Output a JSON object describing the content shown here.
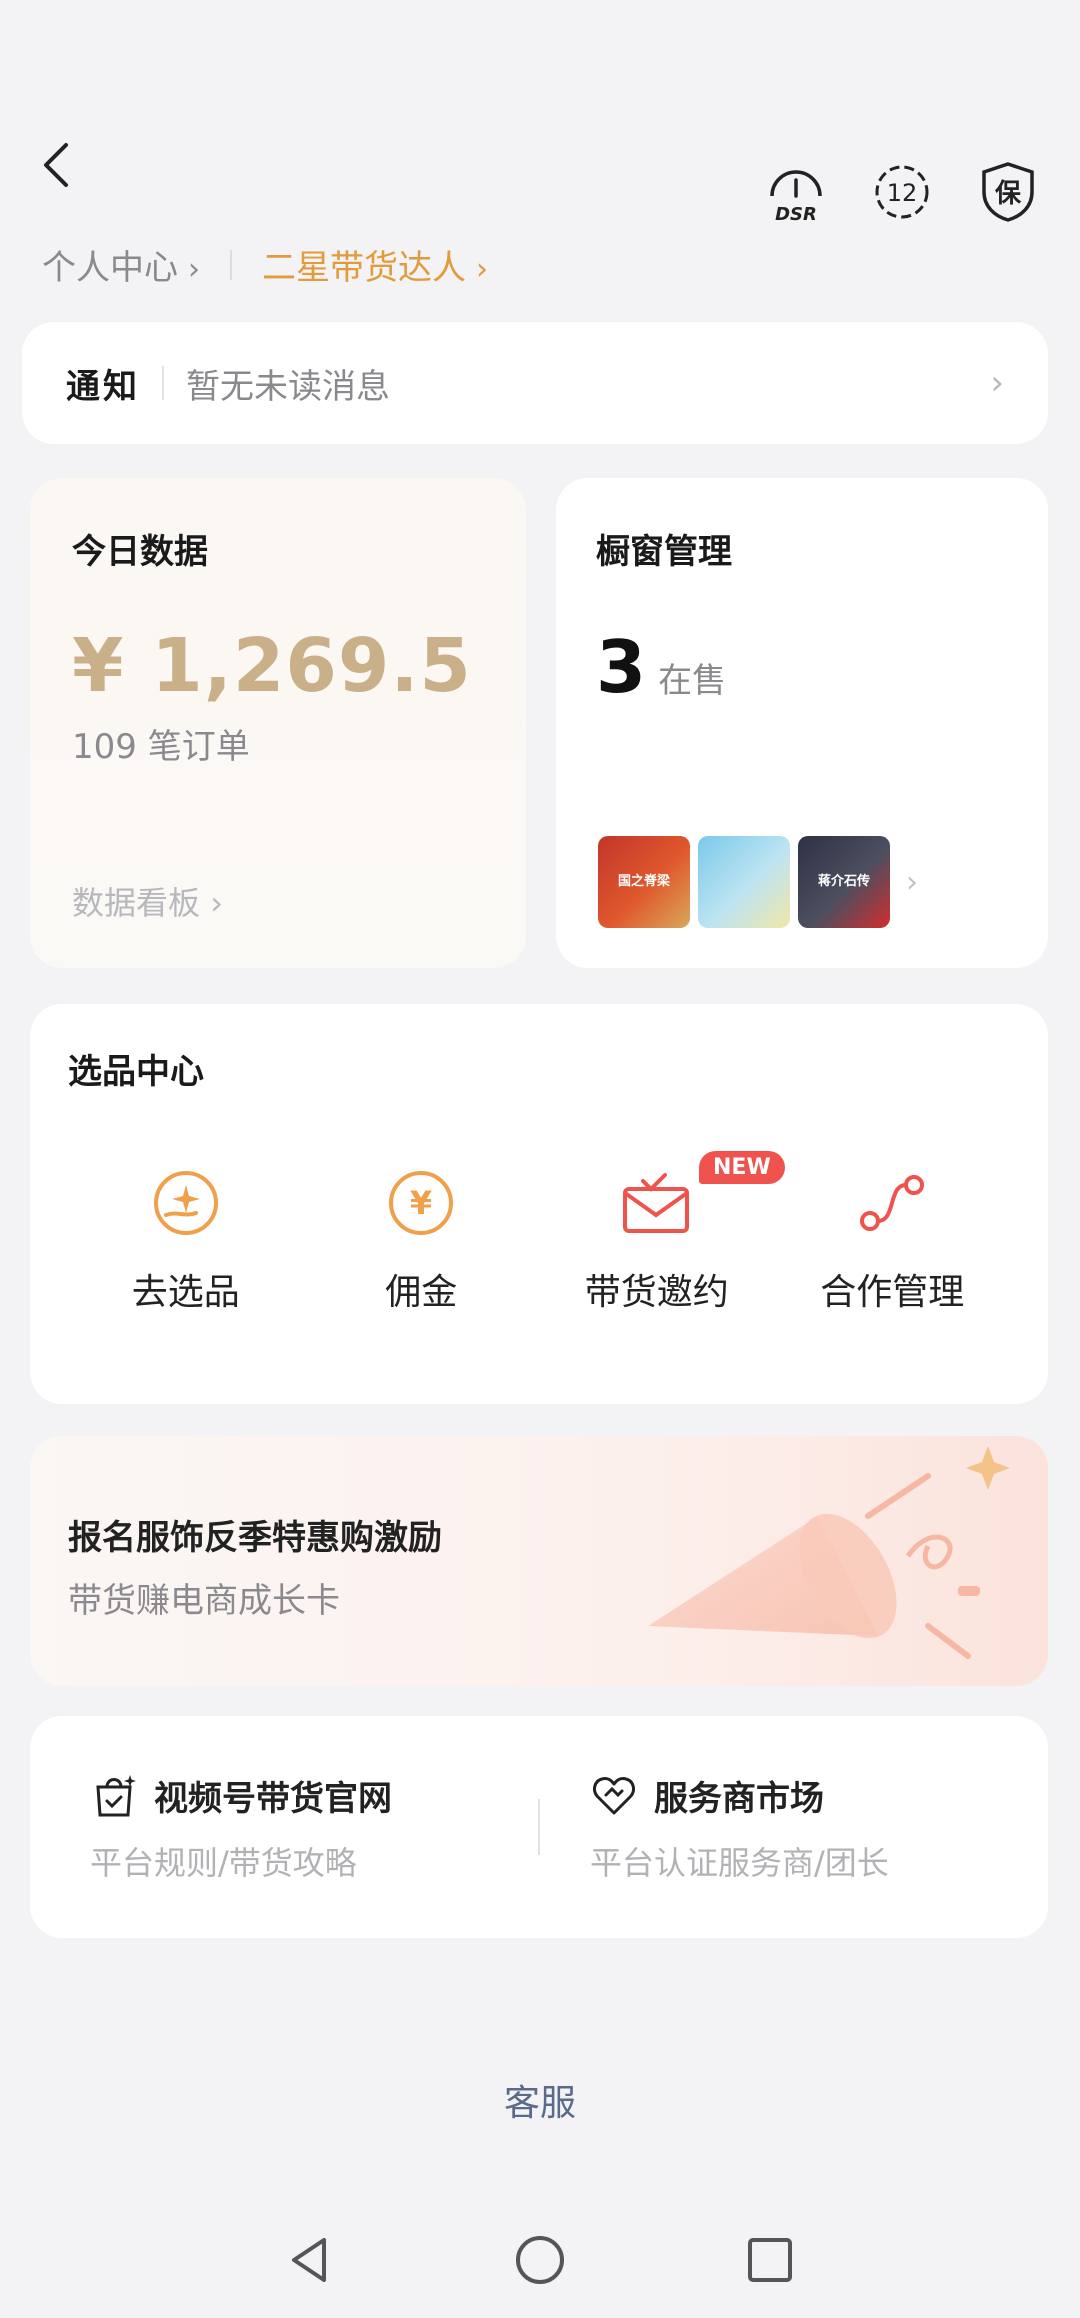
{
  "breadcrumbs": {
    "first": "个人中心",
    "second": "二星带货达人"
  },
  "top_icons": {
    "dsr_label": "DSR",
    "level_number": "12",
    "guarantee_label": "保"
  },
  "notice": {
    "title": "通知",
    "text": "暂无未读消息"
  },
  "today": {
    "title": "今日数据",
    "amount": "¥ 1,269.5",
    "orders": "109 笔订单",
    "link": "数据看板"
  },
  "window": {
    "title": "橱窗管理",
    "count": "3",
    "count_label": "在售",
    "thumbnails": [
      {
        "caption": "国之脊梁"
      },
      {
        "caption": ""
      },
      {
        "caption": "蒋介石传"
      }
    ]
  },
  "center": {
    "title": "选品中心",
    "items": [
      {
        "label": "去选品",
        "icon": "select-product-icon"
      },
      {
        "label": "佣金",
        "icon": "commission-icon"
      },
      {
        "label": "带货邀约",
        "icon": "invitation-icon",
        "badge": "NEW"
      },
      {
        "label": "合作管理",
        "icon": "cooperation-icon"
      }
    ]
  },
  "banner": {
    "title": "报名服饰反季特惠购激励",
    "subtitle": "带货赚电商成长卡"
  },
  "links": [
    {
      "title": "视频号带货官网",
      "subtitle": "平台规则/带货攻略",
      "icon": "bag-check-icon"
    },
    {
      "title": "服务商市场",
      "subtitle": "平台认证服务商/团长",
      "icon": "heart-handshake-icon"
    }
  ],
  "service_label": "客服",
  "colors": {
    "accent_gold": "#c9b088",
    "accent_orange": "#e29b3c",
    "icon_orange": "#f0a04b",
    "badge_red": "#f0524d",
    "service_blue": "#5a6a8a"
  }
}
